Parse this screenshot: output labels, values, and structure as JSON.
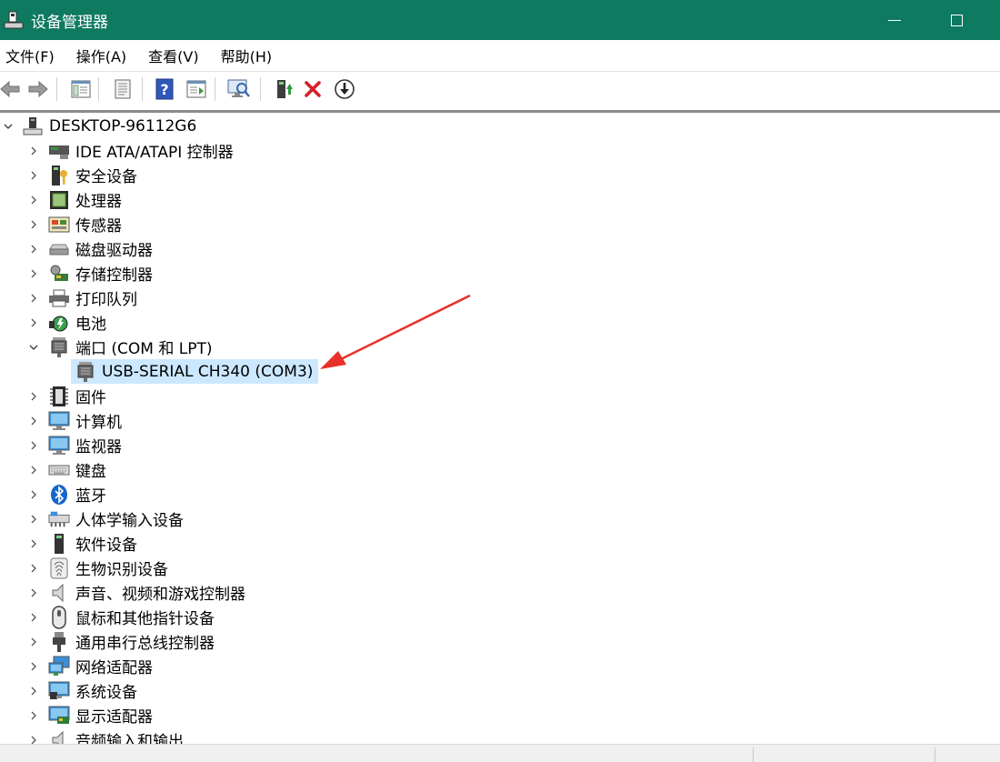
{
  "window": {
    "title": "设备管理器"
  },
  "menu": [
    {
      "label": "文件(F)"
    },
    {
      "label": "操作(A)"
    },
    {
      "label": "查看(V)"
    },
    {
      "label": "帮助(H)"
    }
  ],
  "toolbar": {
    "icons": [
      "back-icon",
      "forward-icon",
      "show-hide-console-tree-icon",
      "properties-icon",
      "help-icon",
      "action-pane-icon",
      "scan-hardware-icon",
      "update-driver-icon",
      "uninstall-icon",
      "disable-device-icon"
    ]
  },
  "tree": {
    "root": {
      "label": "DESKTOP-96112G6",
      "icon": "computer-tower-icon"
    },
    "categories": [
      {
        "label": "IDE ATA/ATAPI 控制器",
        "icon": "ide-controller-icon"
      },
      {
        "label": "安全设备",
        "icon": "security-device-icon"
      },
      {
        "label": "处理器",
        "icon": "processor-icon"
      },
      {
        "label": "传感器",
        "icon": "sensor-icon"
      },
      {
        "label": "磁盘驱动器",
        "icon": "disk-drive-icon"
      },
      {
        "label": "存储控制器",
        "icon": "storage-controller-icon"
      },
      {
        "label": "打印队列",
        "icon": "printer-icon"
      },
      {
        "label": "电池",
        "icon": "battery-icon"
      },
      {
        "label": "端口 (COM 和 LPT)",
        "icon": "port-icon",
        "expanded": true,
        "children": [
          {
            "label": "USB-SERIAL CH340 (COM3)",
            "icon": "port-icon",
            "selected": true
          }
        ]
      },
      {
        "label": "固件",
        "icon": "firmware-icon"
      },
      {
        "label": "计算机",
        "icon": "computer-monitor-icon"
      },
      {
        "label": "监视器",
        "icon": "monitor-icon"
      },
      {
        "label": "键盘",
        "icon": "keyboard-icon"
      },
      {
        "label": "蓝牙",
        "icon": "bluetooth-icon"
      },
      {
        "label": "人体学输入设备",
        "icon": "hid-icon"
      },
      {
        "label": "软件设备",
        "icon": "software-device-icon"
      },
      {
        "label": "生物识别设备",
        "icon": "fingerprint-icon"
      },
      {
        "label": "声音、视频和游戏控制器",
        "icon": "speaker-icon"
      },
      {
        "label": "鼠标和其他指针设备",
        "icon": "mouse-icon"
      },
      {
        "label": "通用串行总线控制器",
        "icon": "usb-icon"
      },
      {
        "label": "网络适配器",
        "icon": "network-adapter-icon"
      },
      {
        "label": "系统设备",
        "icon": "system-device-icon"
      },
      {
        "label": "显示适配器",
        "icon": "display-adapter-icon"
      },
      {
        "label": "音频输入和输出",
        "icon": "audio-io-icon"
      }
    ]
  },
  "colors": {
    "titlebar": "#0e7a60",
    "selection": "#cce8ff",
    "annotation_arrow": "#e8312a"
  }
}
